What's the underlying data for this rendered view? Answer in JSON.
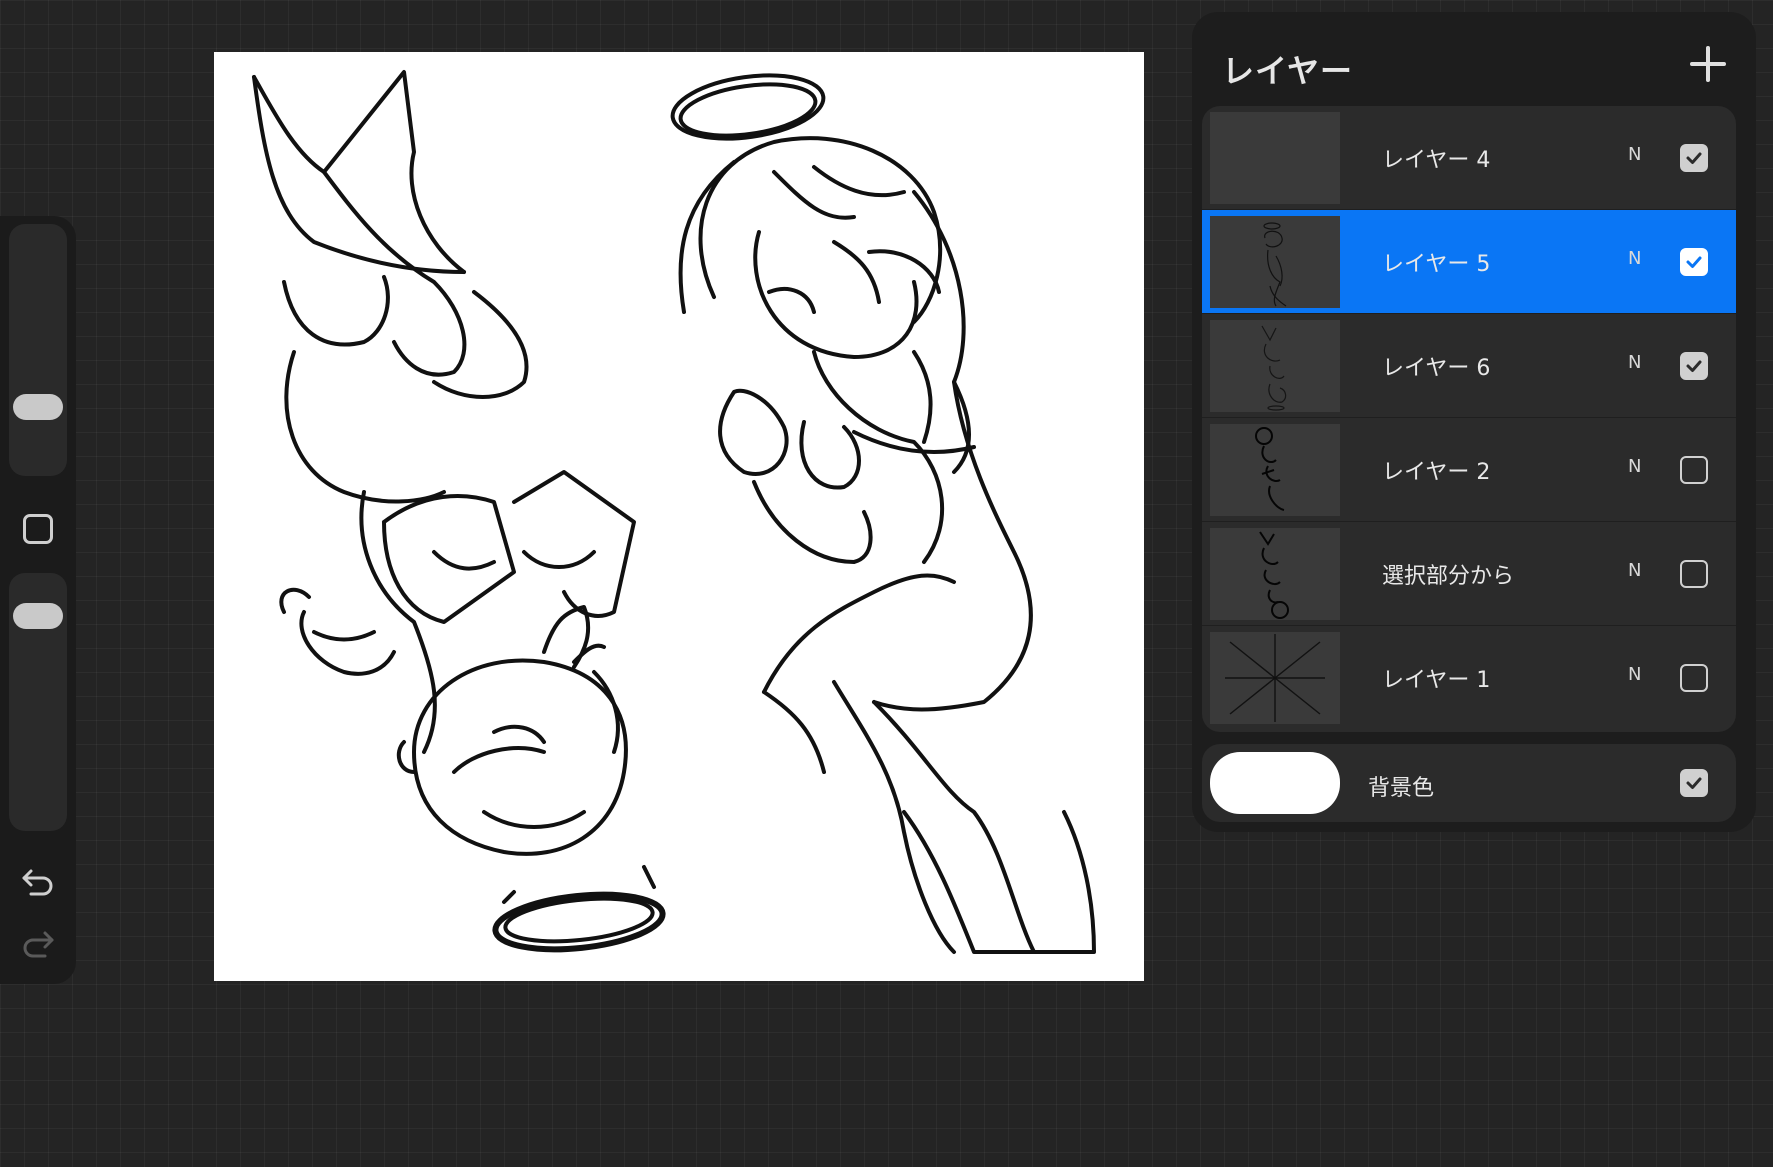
{
  "colors": {
    "background": "#242424",
    "panel": "#1d1d1d",
    "row": "#2b2b2b",
    "accent": "#0a76f5",
    "canvas": "#ffffff"
  },
  "sidebar": {
    "icons": [
      "brush-size-slider",
      "modify-button",
      "opacity-slider",
      "undo-icon",
      "redo-icon"
    ]
  },
  "layers": {
    "title": "レイヤー",
    "items": [
      {
        "name": "レイヤー 4",
        "blend": "N",
        "visible": true,
        "active": false
      },
      {
        "name": "レイヤー 5",
        "blend": "N",
        "visible": true,
        "active": true
      },
      {
        "name": "レイヤー 6",
        "blend": "N",
        "visible": true,
        "active": false
      },
      {
        "name": "レイヤー 2",
        "blend": "N",
        "visible": false,
        "active": false
      },
      {
        "name": "選択部分から",
        "blend": "N",
        "visible": false,
        "active": false
      },
      {
        "name": "レイヤー 1",
        "blend": "N",
        "visible": false,
        "active": false
      }
    ],
    "background": {
      "name": "背景色",
      "visible": true,
      "color": "#ffffff"
    }
  }
}
